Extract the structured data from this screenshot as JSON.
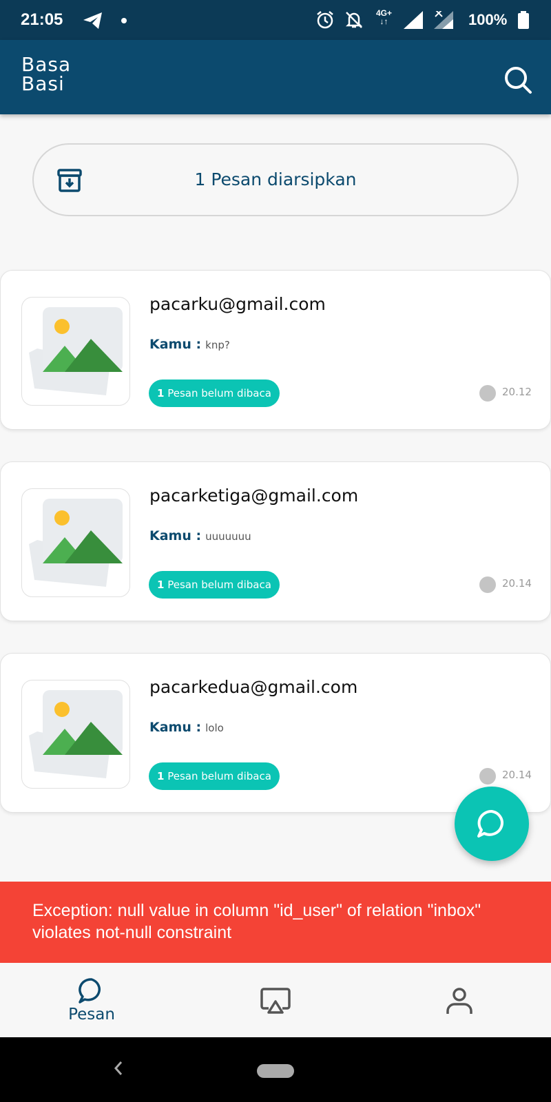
{
  "status_bar": {
    "time": "21:05",
    "network": "4G+",
    "battery": "100%",
    "icons": [
      "telegram-icon",
      "dot-icon",
      "alarm-icon",
      "bell-off-icon",
      "signal-icon",
      "signal-off-icon",
      "battery-icon"
    ]
  },
  "app_bar": {
    "logo_line1": "Basa",
    "logo_line2": "Basi",
    "search_icon": "search-icon"
  },
  "archive": {
    "label": "1 Pesan diarsipkan",
    "icon": "archive-icon"
  },
  "chats": [
    {
      "email": "pacarku@gmail.com",
      "sender": "Kamu :",
      "message": "knp?",
      "unread_count": "1",
      "unread_label": "Pesan belum dibaca",
      "time": "20.12"
    },
    {
      "email": "pacarketiga@gmail.com",
      "sender": "Kamu :",
      "message": "uuuuuuu",
      "unread_count": "1",
      "unread_label": "Pesan belum dibaca",
      "time": "20.14"
    },
    {
      "email": "pacarkedua@gmail.com",
      "sender": "Kamu :",
      "message": "lolo",
      "unread_count": "1",
      "unread_label": "Pesan belum dibaca",
      "time": "20.14"
    }
  ],
  "snackbar": {
    "message": "Exception: null value in column \"id_user\" of relation \"inbox\" violates not-null constraint"
  },
  "bottom_nav": {
    "pesan_label": "Pesan",
    "items": [
      "chat-icon",
      "cast-icon",
      "person-icon"
    ]
  },
  "colors": {
    "primary": "#0c4a6e",
    "status_bar": "#0c3a56",
    "accent": "#0bc4b4",
    "error": "#f44336"
  }
}
